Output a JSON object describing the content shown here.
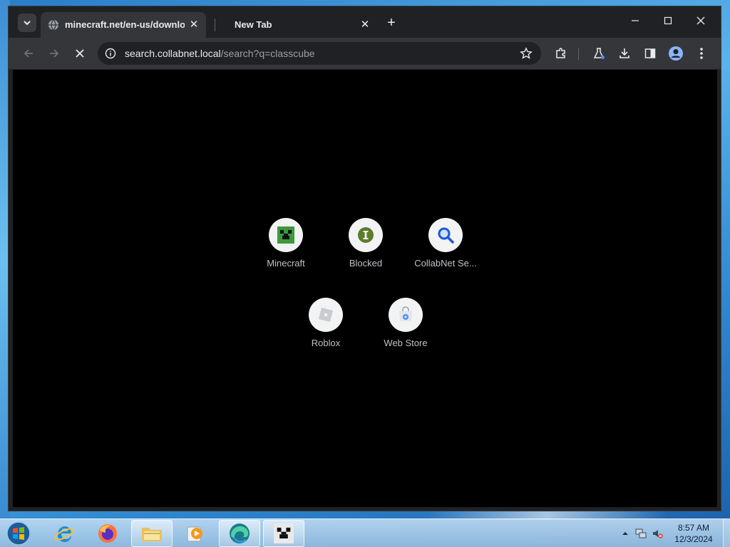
{
  "browser": {
    "tabs": [
      {
        "title": "minecraft.net/en-us/download",
        "active": true
      },
      {
        "title": "New Tab",
        "active": false
      }
    ],
    "omnibox": {
      "host": "search.collabnet.local",
      "path": "/search?q=classcube"
    },
    "window_controls": {
      "minimize": "—",
      "maximize": "☐",
      "close": "✕"
    }
  },
  "new_tab_page": {
    "shortcuts": [
      {
        "label": "Minecraft",
        "icon": "minecraft-creeper-icon"
      },
      {
        "label": "Blocked",
        "icon": "blocked-icon"
      },
      {
        "label": "CollabNet Se...",
        "icon": "search-icon"
      },
      {
        "label": "Roblox",
        "icon": "roblox-icon"
      },
      {
        "label": "Web Store",
        "icon": "web-store-icon"
      }
    ]
  },
  "taskbar": {
    "apps": [
      "start-orb",
      "internet-explorer",
      "firefox",
      "file-explorer",
      "media-player",
      "edge",
      "minecraft"
    ],
    "clock": {
      "time": "8:57 AM",
      "date": "12/3/2024"
    }
  },
  "colors": {
    "browser_frame": "#202124",
    "toolbar": "#35363a",
    "page_background": "#000000",
    "shortcut_label": "#bdc1c6"
  }
}
